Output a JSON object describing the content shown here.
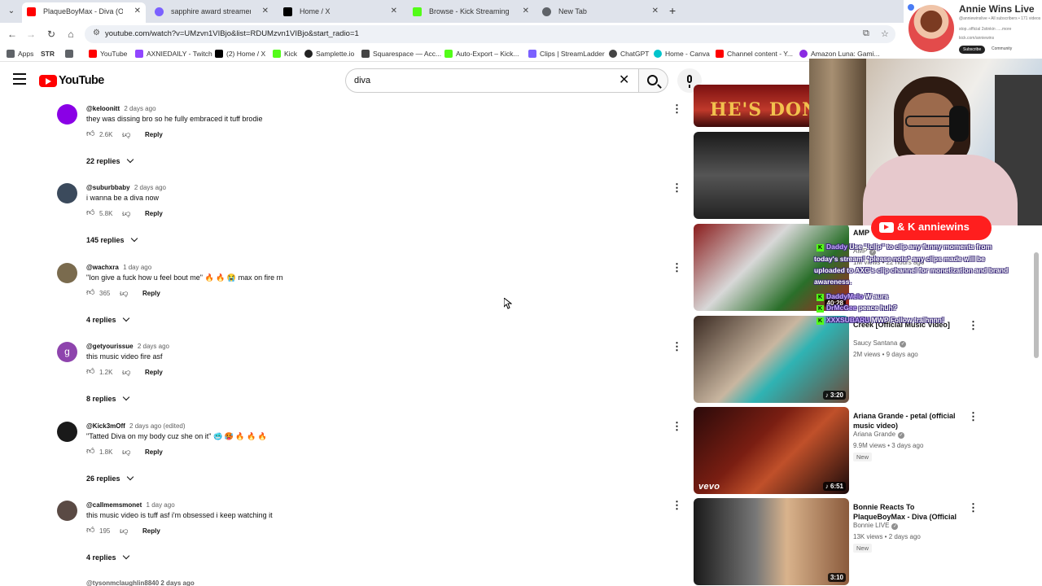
{
  "browser": {
    "tabs": [
      {
        "title": "PlaqueBoyMax - Diva (Official M",
        "color": "#ff0000",
        "active": true
      },
      {
        "title": "sapphire award streamer award",
        "color": "#7b61ff",
        "active": false
      },
      {
        "title": "Home / X",
        "color": "#000000",
        "active": false
      },
      {
        "title": "Browse - Kick Streaming",
        "color": "#53fc18",
        "active": false
      },
      {
        "title": "New Tab",
        "color": "#5f6368",
        "active": false
      }
    ],
    "url": "youtube.com/watch?v=UMzvn1VIBjo&list=RDUMzvn1VIBjo&start_radio=1",
    "bookmarks": [
      {
        "label": "Apps",
        "color": "#5f6368"
      },
      {
        "label": "STR",
        "color": "#ffffff"
      },
      {
        "label": "",
        "color": "#5f6368"
      },
      {
        "label": "YouTube",
        "color": "#ff0000"
      },
      {
        "label": "AXNIEDAILY - Twitch",
        "color": "#9146ff"
      },
      {
        "label": "(2) Home / X",
        "color": "#000000"
      },
      {
        "label": "Kick",
        "color": "#53fc18"
      },
      {
        "label": "Samplette.io",
        "color": "#222222"
      },
      {
        "label": "Squarespace — Acc...",
        "color": "#444444"
      },
      {
        "label": "Auto-Export – Kick...",
        "color": "#53fc18"
      },
      {
        "label": "Clips | StreamLadder",
        "color": "#7b61ff"
      },
      {
        "label": "ChatGPT",
        "color": "#444444"
      },
      {
        "label": "Home - Canva",
        "color": "#00c4cc"
      },
      {
        "label": "Channel content - Y...",
        "color": "#ff0000"
      },
      {
        "label": "Amazon Luna: Gami...",
        "color": "#8a2be2"
      }
    ]
  },
  "youtube": {
    "logo": "YouTube",
    "search_query": "diva"
  },
  "comments": [
    {
      "author": "@keloonitt",
      "date": "2 days ago",
      "text": "they was dissing bro so he fully embraced it tuff brodie",
      "likes": "2.6K",
      "replies": "22 replies",
      "avatar_color": "#8a00e6",
      "avatar_letter": "",
      "reply_label": "Reply"
    },
    {
      "author": "@suburbbaby",
      "date": "2 days ago",
      "text": "i wanna be a diva now",
      "likes": "5.8K",
      "replies": "145 replies",
      "avatar_color": "#3b4a5c",
      "avatar_letter": "",
      "reply_label": "Reply"
    },
    {
      "author": "@wachxra",
      "date": "1 day ago",
      "text": "\"Ion give a fuck how u feel bout me\" 🔥 🔥 😭 max on fire rn",
      "likes": "365",
      "replies": "4 replies",
      "avatar_color": "#7a6b4e",
      "avatar_letter": "",
      "reply_label": "Reply"
    },
    {
      "author": "@getyourissue",
      "date": "2 days ago",
      "text": "this music video fire asf",
      "likes": "1.2K",
      "replies": "8 replies",
      "avatar_color": "#8e44ad",
      "avatar_letter": "g",
      "reply_label": "Reply"
    },
    {
      "author": "@Kick3mOff",
      "date": "2 days ago (edited)",
      "text": "\"Tatted Diva on my body cuz she on it\" 🥶 🥵 🔥 🔥 🔥",
      "likes": "1.8K",
      "replies": "26 replies",
      "avatar_color": "#1a1a1a",
      "avatar_letter": "",
      "reply_label": "Reply"
    },
    {
      "author": "@callmemsmonet",
      "date": "1 day ago",
      "text": "this music video is tuff asf i'm obsessed i keep watching it",
      "likes": "195",
      "replies": "4 replies",
      "avatar_color": "#5a4a44",
      "avatar_letter": "",
      "reply_label": "Reply"
    }
  ],
  "comment_tail": "@tysonmclaughlin8840  2 days ago",
  "recommendations": [
    {
      "title": "",
      "channel": "",
      "stats": "",
      "duration": "",
      "badge": "",
      "thumb": "linear-gradient(180deg,#7a1010,#c0392b 60%,#3b0a0a)",
      "thumb_text": "HE'S DON"
    },
    {
      "title": "",
      "channel": "",
      "stats": "",
      "duration": "",
      "badge": "",
      "thumb": "linear-gradient(180deg,#1a1a1a,#555 50%,#222)",
      "thumb_text": ""
    },
    {
      "title": "AMP",
      "channel": "AMP",
      "stats": "1M views • 22 hours ago",
      "duration": "40:28",
      "badge": "",
      "thumb": "linear-gradient(135deg,#8a1c1c,#d8d8d8 40%,#2a6f2a 70%,#b02020)",
      "thumb_text": ""
    },
    {
      "title": "Creek [Official Music Video]",
      "channel": "Saucy Santana",
      "stats": "2M views • 9 days ago",
      "duration": "♪ 3:20",
      "badge": "",
      "thumb": "linear-gradient(135deg,#3a2a22,#c9b6a0 45%,#2fb3b3 60%,#6b4a3a)",
      "thumb_text": ""
    },
    {
      "title": "Ariana Grande - petal (official music video)",
      "channel": "Ariana Grande",
      "stats": "9.9M views • 3 days ago",
      "duration": "♪ 6:51",
      "badge": "New",
      "thumb": "linear-gradient(135deg,#2a0a0a,#7a1e12 40%,#c0502a 60%,#1a0a0a)",
      "thumb_text": "vevo"
    },
    {
      "title": "Bonnie Reacts To PlaqueBoyMax - Diva (Official ...",
      "channel": "Bonnie LIVE",
      "stats": "13K views • 2 days ago",
      "duration": "3:10",
      "badge": "New",
      "thumb": "linear-gradient(90deg,#1a1a1a,#777 40%,#d9b38c 60%,#8a5a3c)",
      "thumb_text": ""
    }
  ],
  "overlay": {
    "name": "Annie Wins Live",
    "handle": "@anniewinslive • All subscribers • 171 videos",
    "about": "stop..official 2stinkin .....more",
    "link": "kick.com/anniewins",
    "subscribe": "Subscribe",
    "community": "Community",
    "badge_text": "& K anniewins",
    "chat": [
      {
        "user": "Daddy",
        "msg": "Use \"!clip\" to clip any funny moments from"
      },
      {
        "user": "",
        "msg": "today's stream! *please note* any clips made will be"
      },
      {
        "user": "",
        "msg": "uploaded to AXC's clip channel for monetization and brand"
      },
      {
        "user": "",
        "msg": "awareness."
      },
      {
        "user": "DaddyMelo",
        "msg": "W aura"
      },
      {
        "user": "DrMcGee",
        "msg": "peace huh?"
      },
      {
        "user": "XXXSUBARU",
        "msg": "MWP Follow traihnnn!"
      }
    ]
  }
}
